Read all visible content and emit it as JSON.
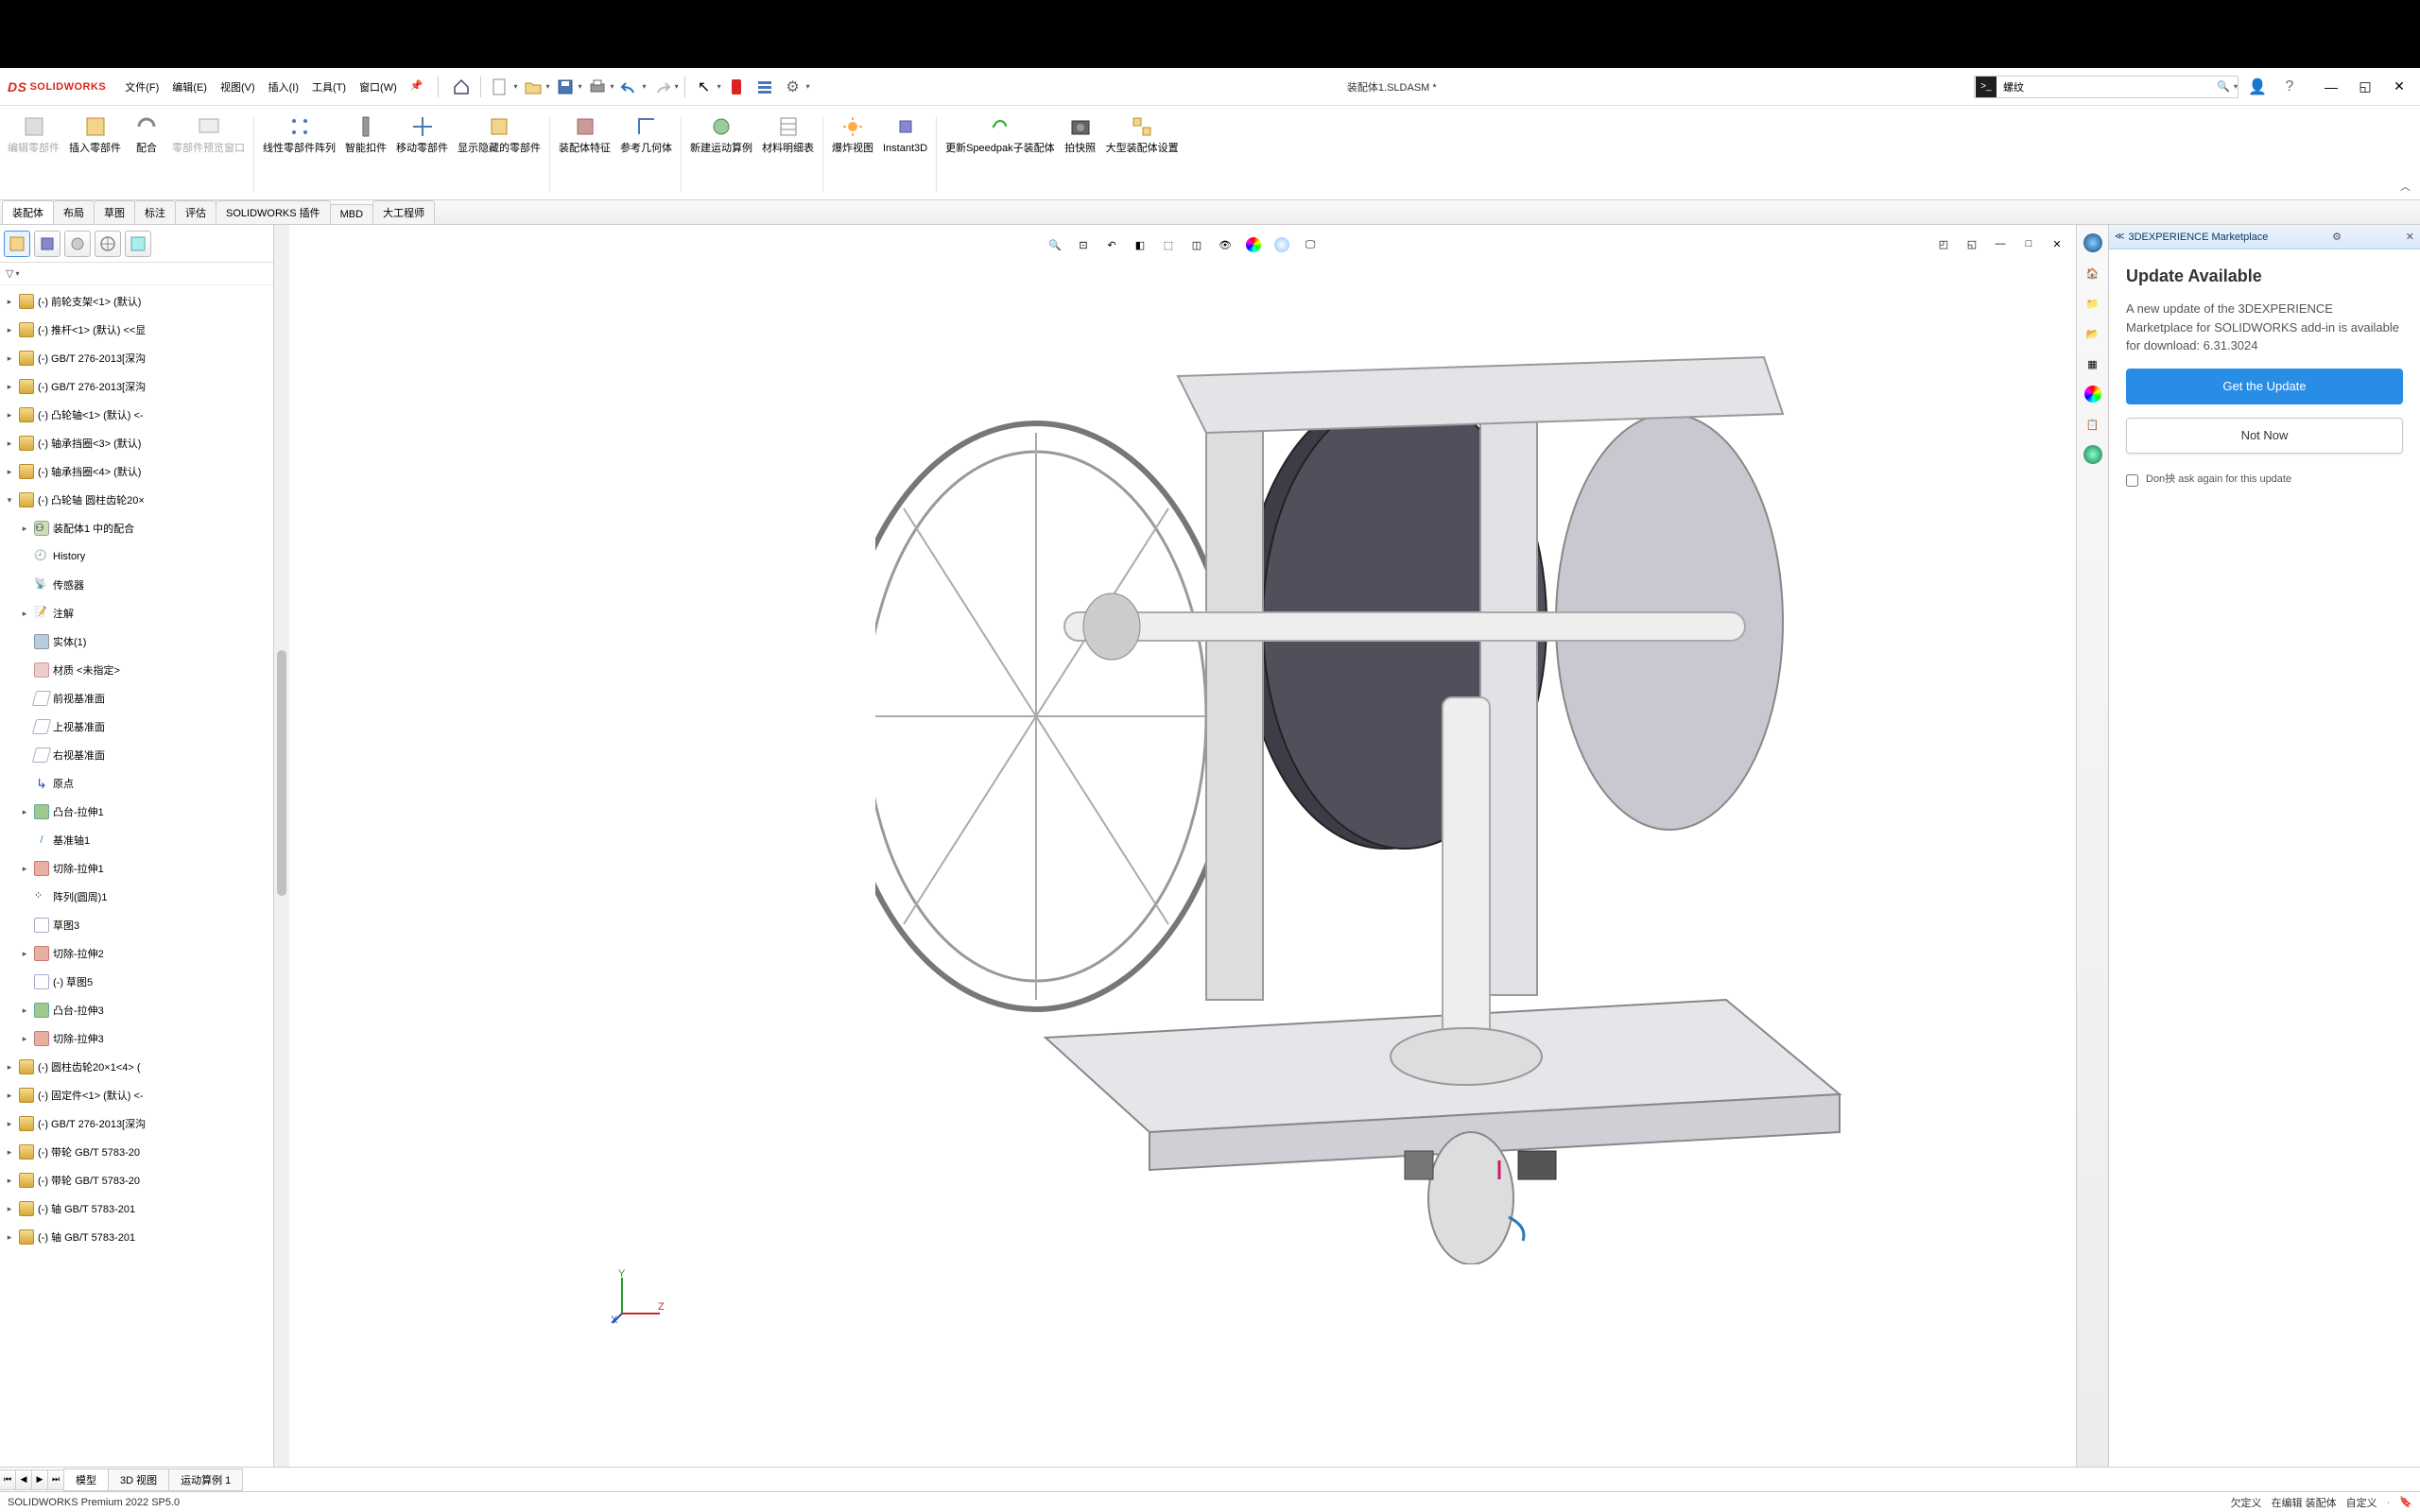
{
  "app": {
    "brand": "SOLIDWORKS",
    "document_title": "装配体1.SLDASM *",
    "search_value": "螺纹"
  },
  "menu": {
    "file": "文件(F)",
    "edit": "编辑(E)",
    "view": "视图(V)",
    "insert": "插入(I)",
    "tools": "工具(T)",
    "window": "窗口(W)"
  },
  "ribbon": {
    "edit_component": "编辑零部件",
    "insert_components": "插入零部件",
    "mate": "配合",
    "preview_window": "零部件预览窗口",
    "linear_pattern": "线性零部件阵列",
    "smart_fasteners": "智能扣件",
    "move_component": "移动零部件",
    "show_hidden": "显示隐藏的零部件",
    "assembly_features": "装配体特征",
    "reference_geometry": "参考几何体",
    "new_motion_study": "新建运动算例",
    "bom": "材料明细表",
    "exploded_view": "爆炸视图",
    "instant3d": "Instant3D",
    "update_speedpak": "更新Speedpak子装配体",
    "snapshot": "拍快照",
    "large_assembly": "大型装配体设置"
  },
  "tabs": [
    "装配体",
    "布局",
    "草图",
    "标注",
    "评估",
    "SOLIDWORKS 插件",
    "MBD",
    "大工程师"
  ],
  "active_tab": 0,
  "tree": [
    {
      "depth": 0,
      "ar": "▸",
      "icon": "part",
      "label": "(-) 前轮支架<1> (默认)"
    },
    {
      "depth": 0,
      "ar": "▸",
      "icon": "part",
      "label": "(-) 推杆<1> (默认) <<显"
    },
    {
      "depth": 0,
      "ar": "▸",
      "icon": "part",
      "label": "(-) GB/T 276-2013[深沟"
    },
    {
      "depth": 0,
      "ar": "▸",
      "icon": "part",
      "label": "(-) GB/T 276-2013[深沟"
    },
    {
      "depth": 0,
      "ar": "▸",
      "icon": "part",
      "label": "(-) 凸轮轴<1> (默认) <-"
    },
    {
      "depth": 0,
      "ar": "▸",
      "icon": "part",
      "label": "(-) 轴承挡圈<3> (默认)"
    },
    {
      "depth": 0,
      "ar": "▸",
      "icon": "part",
      "label": "(-) 轴承挡圈<4> (默认)"
    },
    {
      "depth": 0,
      "ar": "▾",
      "icon": "part",
      "label": "(-) 凸轮轴 圆柱齿轮20×"
    },
    {
      "depth": 1,
      "ar": "▸",
      "icon": "mate",
      "label": "装配体1 中的配合"
    },
    {
      "depth": 1,
      "ar": "",
      "icon": "history",
      "label": "History"
    },
    {
      "depth": 1,
      "ar": "",
      "icon": "sensor",
      "label": "传感器"
    },
    {
      "depth": 1,
      "ar": "▸",
      "icon": "note",
      "label": "注解"
    },
    {
      "depth": 1,
      "ar": "",
      "icon": "solid",
      "label": "实体(1)"
    },
    {
      "depth": 1,
      "ar": "",
      "icon": "material",
      "label": "材质 <未指定>"
    },
    {
      "depth": 1,
      "ar": "",
      "icon": "plane",
      "label": "前视基准面"
    },
    {
      "depth": 1,
      "ar": "",
      "icon": "plane",
      "label": "上视基准面"
    },
    {
      "depth": 1,
      "ar": "",
      "icon": "plane",
      "label": "右视基准面"
    },
    {
      "depth": 1,
      "ar": "",
      "icon": "origin",
      "label": "原点"
    },
    {
      "depth": 1,
      "ar": "▸",
      "icon": "feat",
      "label": "凸台-拉伸1"
    },
    {
      "depth": 1,
      "ar": "",
      "icon": "axis",
      "label": "基准轴1"
    },
    {
      "depth": 1,
      "ar": "▸",
      "icon": "cut",
      "label": "切除-拉伸1"
    },
    {
      "depth": 1,
      "ar": "",
      "icon": "pattern",
      "label": "阵列(圆周)1"
    },
    {
      "depth": 1,
      "ar": "",
      "icon": "sketch",
      "label": "草图3"
    },
    {
      "depth": 1,
      "ar": "▸",
      "icon": "cut",
      "label": "切除-拉伸2"
    },
    {
      "depth": 1,
      "ar": "",
      "icon": "sketch",
      "label": "(-) 草图5"
    },
    {
      "depth": 1,
      "ar": "▸",
      "icon": "feat",
      "label": "凸台-拉伸3"
    },
    {
      "depth": 1,
      "ar": "▸",
      "icon": "cut",
      "label": "切除-拉伸3"
    },
    {
      "depth": 0,
      "ar": "▸",
      "icon": "part",
      "label": "(-) 圆柱齿轮20×1<4> ("
    },
    {
      "depth": 0,
      "ar": "▸",
      "icon": "part",
      "label": "(-) 固定件<1> (默认) <-"
    },
    {
      "depth": 0,
      "ar": "▸",
      "icon": "part",
      "label": "(-) GB/T 276-2013[深沟"
    },
    {
      "depth": 0,
      "ar": "▸",
      "icon": "part",
      "label": "(-) 带轮 GB/T 5783-20"
    },
    {
      "depth": 0,
      "ar": "▸",
      "icon": "part",
      "label": "(-) 带轮 GB/T 5783-20"
    },
    {
      "depth": 0,
      "ar": "▸",
      "icon": "part",
      "label": "(-) 轴  GB/T 5783-201"
    },
    {
      "depth": 0,
      "ar": "▸",
      "icon": "part",
      "label": "(-) 轴  GB/T 5783-201"
    }
  ],
  "bottom_tabs": [
    "模型",
    "3D 视图",
    "运动算例 1"
  ],
  "panel": {
    "header": "3DEXPERIENCE Marketplace",
    "title": "Update Available",
    "body_text": "A new update of the 3DEXPERIENCE Marketplace for SOLIDWORKS add-in is available for download: 6.31.3024",
    "primary_btn": "Get the Update",
    "secondary_btn": "Not Now",
    "checkbox_label": "Don抰 ask again for this update"
  },
  "status": {
    "left": "SOLIDWORKS Premium 2022 SP5.0",
    "right1": "欠定义",
    "right2": "在编辑 装配体",
    "right3": "自定义"
  }
}
